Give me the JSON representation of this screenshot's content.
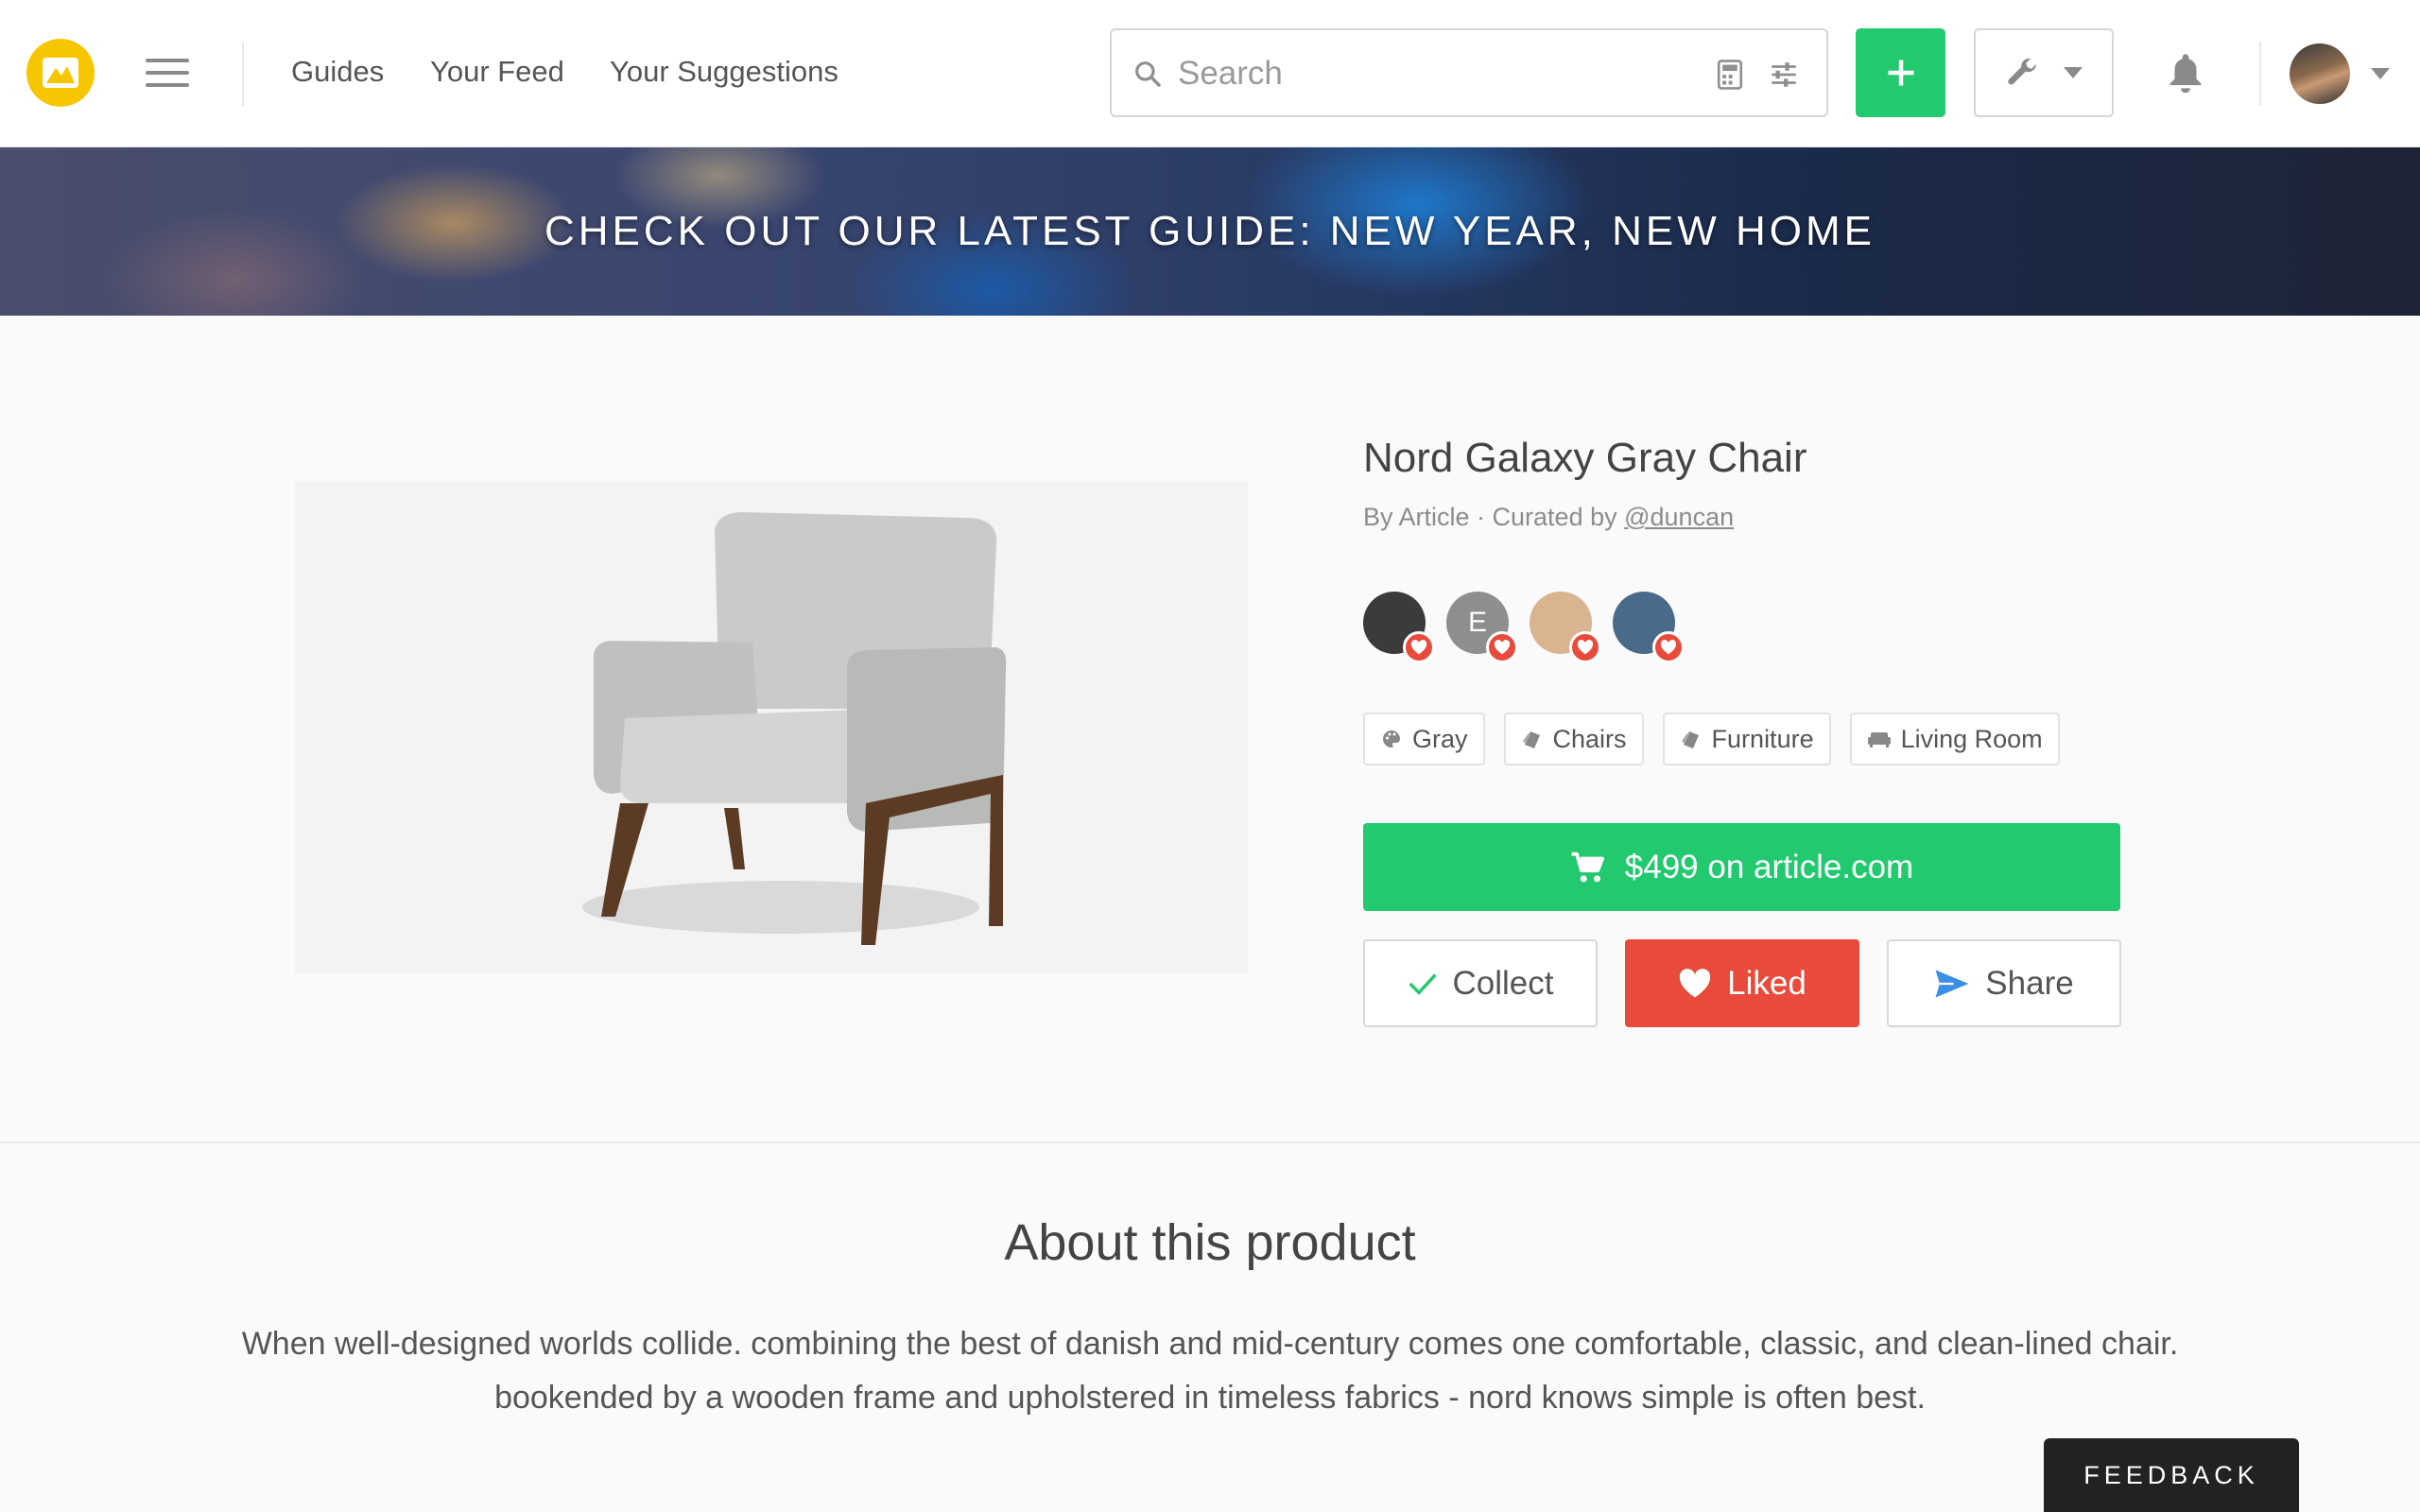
{
  "header": {
    "nav": [
      {
        "label": "Guides"
      },
      {
        "label": "Your Feed"
      },
      {
        "label": "Your Suggestions"
      }
    ],
    "search": {
      "placeholder": "Search",
      "value": ""
    },
    "brand_color": "#f7c600"
  },
  "banner": {
    "text": "CHECK OUT OUR LATEST GUIDE: NEW YEAR, NEW HOME"
  },
  "product": {
    "title": "Nord Galaxy Gray Chair",
    "by_text": "By Article · Curated by ",
    "curator": "@duncan",
    "likers": [
      {
        "letter": "",
        "color": "#3b3b3b"
      },
      {
        "letter": "E",
        "color": "#8e8e8e"
      },
      {
        "letter": "",
        "color": "#d9b48e"
      },
      {
        "letter": "",
        "color": "#4a6a8a"
      }
    ],
    "tags": [
      {
        "label": "Gray",
        "icon": "palette-icon"
      },
      {
        "label": "Chairs",
        "icon": "category-icon"
      },
      {
        "label": "Furniture",
        "icon": "category-icon"
      },
      {
        "label": "Living Room",
        "icon": "sofa-icon"
      }
    ],
    "buy_label": "$499 on article.com",
    "collect_label": "Collect",
    "liked_label": "Liked",
    "share_label": "Share"
  },
  "about": {
    "title": "About this product",
    "description": "When well-designed worlds collide. combining the best of danish and mid-century comes one comfortable, classic, and clean-lined chair. bookended by a wooden frame and upholstered in timeless fabrics - nord knows simple is often best."
  },
  "feedback_label": "FEEDBACK",
  "colors": {
    "green": "#22c96f",
    "red": "#e84b3b",
    "share_blue": "#3a8ee6"
  }
}
